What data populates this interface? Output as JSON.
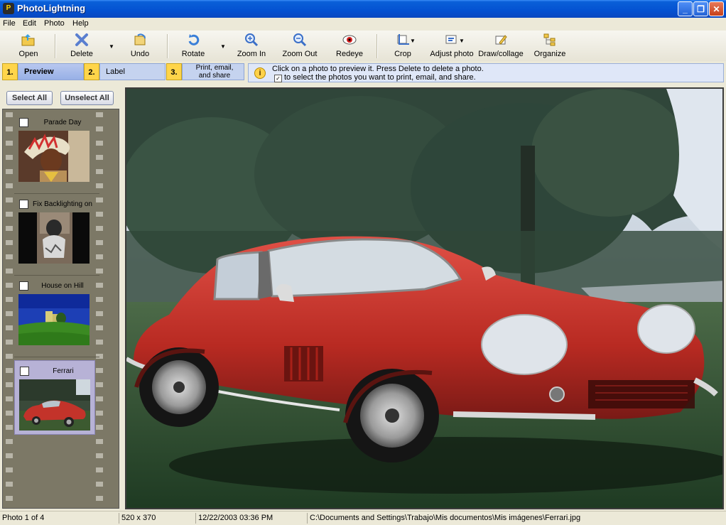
{
  "window": {
    "title": "PhotoLightning",
    "app_icon": "P"
  },
  "menu": [
    "File",
    "Edit",
    "Photo",
    "Help"
  ],
  "toolbar": {
    "open": "Open",
    "delete": "Delete",
    "undo": "Undo",
    "rotate": "Rotate",
    "zoom_in": "Zoom In",
    "zoom_out": "Zoom Out",
    "redeye": "Redeye",
    "crop": "Crop",
    "adjust": "Adjust photo",
    "draw": "Draw/collage",
    "organize": "Organize"
  },
  "steps": [
    {
      "num": "1.",
      "label": "Preview",
      "active": true
    },
    {
      "num": "2.",
      "label": "Label",
      "active": false
    },
    {
      "num": "3.",
      "label_line1": "Print, email,",
      "label_line2": "and share",
      "active": false
    }
  ],
  "info": {
    "line1": "Click on a photo to preview it.  Press Delete to delete a photo.",
    "line2": "to select the photos you want to print, email, and share.",
    "check_glyph": "✓"
  },
  "selection": {
    "select_all": "Select All",
    "unselect_all": "Unselect All"
  },
  "photos": [
    {
      "caption": "Parade Day",
      "selected": false
    },
    {
      "caption": "Fix Backlighting on",
      "selected": false
    },
    {
      "caption": "House on Hill",
      "selected": false
    },
    {
      "caption": "Ferrari",
      "selected": true
    }
  ],
  "status": {
    "count": "Photo 1 of 4",
    "dimensions": "520 x 370",
    "datetime": "12/22/2003  03:36 PM",
    "path": "C:\\Documents and Settings\\Trabajo\\Mis documentos\\Mis imágenes\\Ferrari.jpg"
  },
  "colors": {
    "title_bar": "#0452d1",
    "step_active": "#98b0e6",
    "car": "#c3332a"
  }
}
